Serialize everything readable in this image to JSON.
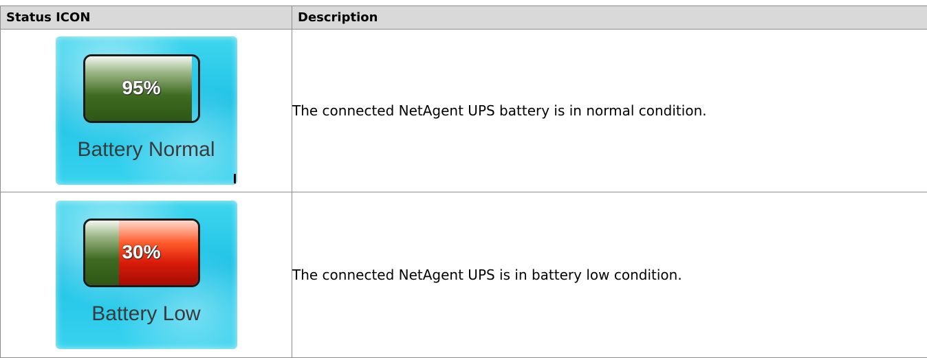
{
  "table": {
    "headers": {
      "icon": "Status ICON",
      "description": "Description"
    },
    "rows": [
      {
        "percent": "95%",
        "level": 0.95,
        "label": "Battery Normal",
        "description": "The connected NetAgent UPS battery is in normal condition."
      },
      {
        "percent": "30%",
        "level": 0.3,
        "label": "Battery Low",
        "description": "The connected NetAgent UPS is in battery low condition."
      }
    ]
  },
  "colors": {
    "header_bg": "#d9d9d9",
    "tile_bg": "#1fc2e6",
    "battery_green": "#3f6b22",
    "battery_red": "#d91c0a"
  },
  "icons": [
    "battery-icon"
  ]
}
